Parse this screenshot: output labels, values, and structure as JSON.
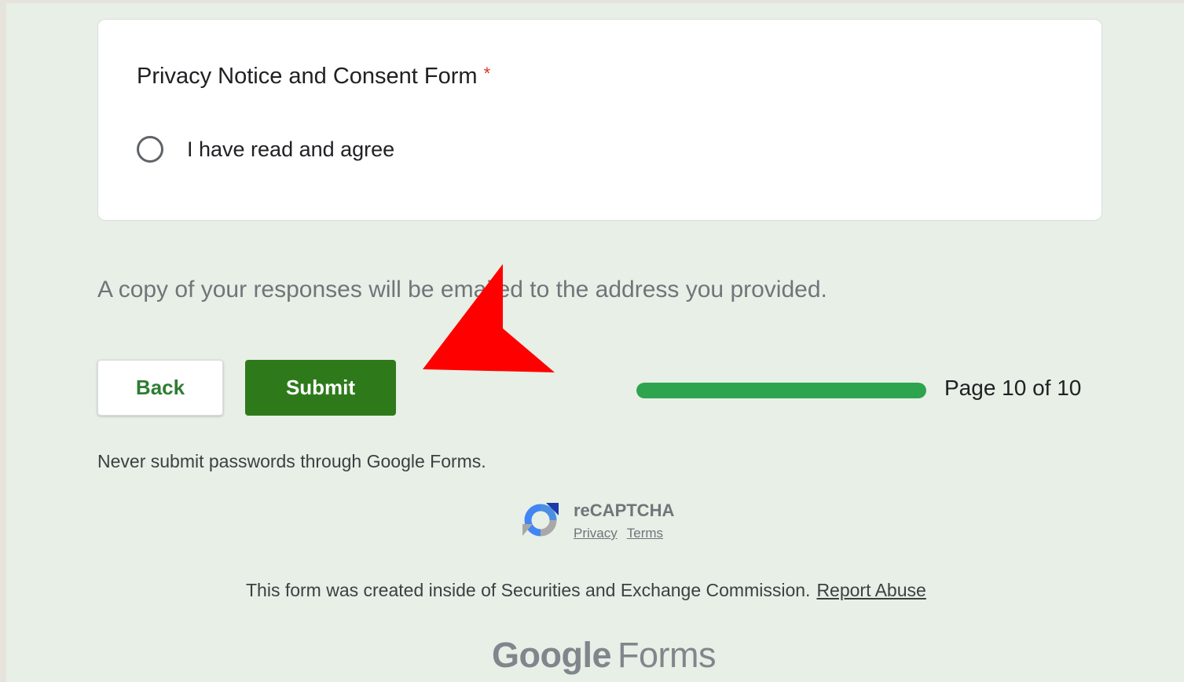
{
  "question": {
    "title": "Privacy Notice and Consent Form",
    "required_marker": "*",
    "options": [
      {
        "label": "I have read and agree",
        "selected": false
      }
    ]
  },
  "confirmation_note": "A copy of your responses will be emailed to the address you provided.",
  "navigation": {
    "back_label": "Back",
    "submit_label": "Submit"
  },
  "progress": {
    "label": "Page 10 of 10",
    "current_page": 10,
    "total_pages": 10
  },
  "password_warning": "Never submit passwords through Google Forms.",
  "recaptcha": {
    "title": "reCAPTCHA",
    "privacy_link": "Privacy",
    "terms_link": "Terms"
  },
  "footer": {
    "created_text": "This form was created inside of Securities and Exchange Commission.",
    "report_link": "Report Abuse"
  },
  "brand": {
    "google": "Google",
    "forms": "Forms"
  },
  "colors": {
    "page_background": "#e8efe6",
    "submit_button": "#2e7a1b",
    "progress_fill": "#2ea44f",
    "required": "#d93025",
    "annotation_arrow": "#ff0000"
  },
  "icons": {
    "recaptcha": "recaptcha-logo-icon",
    "radio": "radio-button-unchecked-icon",
    "annotation": "red-arrow-annotation"
  }
}
